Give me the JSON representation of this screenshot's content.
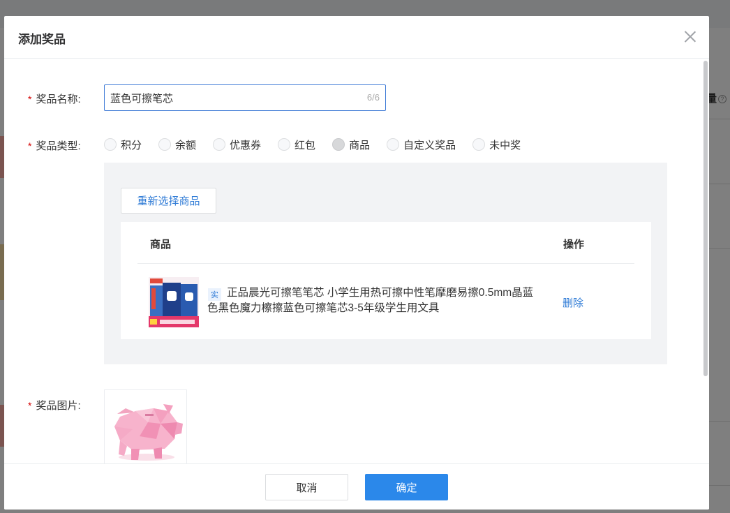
{
  "background": {
    "column_header": "量"
  },
  "dialog": {
    "title": "添加奖品",
    "form": {
      "name": {
        "label": "奖品名称:",
        "value": "蓝色可擦笔芯",
        "count": "6/6"
      },
      "type": {
        "label": "奖品类型:",
        "options": [
          "积分",
          "余额",
          "优惠券",
          "红包",
          "商品",
          "自定义奖品",
          "未中奖"
        ],
        "selected": "商品"
      },
      "goods": {
        "reselect_label": "重新选择商品",
        "col_goods": "商品",
        "col_op": "操作",
        "row": {
          "tag": "实",
          "title": "正品晨光可擦笔笔芯 小学生用热可擦中性笔摩磨易擦0.5mm晶蓝色黑色魔力檫擦蓝色可擦笔芯3-5年级学生用文具",
          "delete_label": "删除"
        }
      },
      "image": {
        "label": "奖品图片:"
      }
    },
    "footer": {
      "cancel_label": "取消",
      "ok_label": "确定"
    }
  },
  "colors": {
    "primary": "#2b88ea",
    "link": "#2f7bd6",
    "required": "#d40000",
    "panel_bg": "#f2f3f5"
  }
}
